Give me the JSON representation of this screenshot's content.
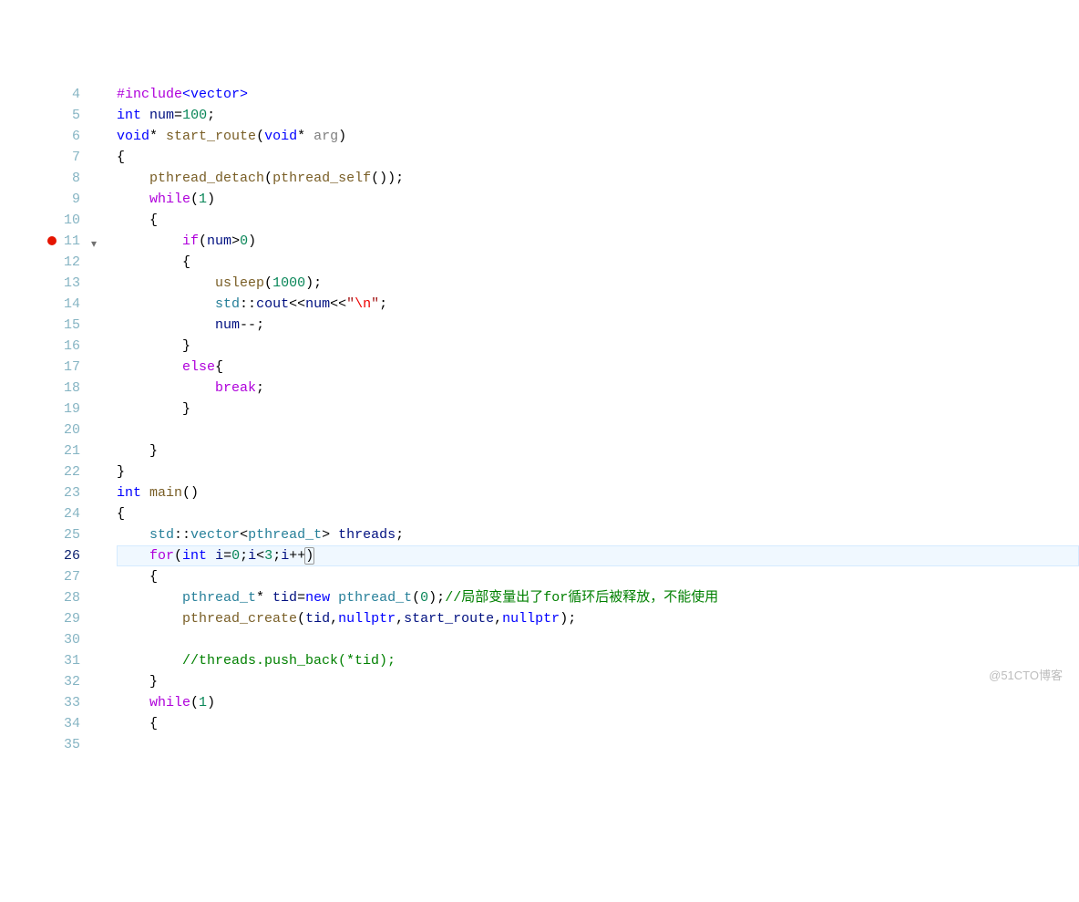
{
  "watermark": "@51CTO博客",
  "startLine": 4,
  "breakpointLine": 11,
  "foldLine": 11,
  "highlightLine": 26,
  "lines": [
    {
      "n": 4,
      "indent": 0,
      "tokens": [
        [
          "tk-macro",
          "#include"
        ],
        [
          "tk-macroinc",
          "<vector>"
        ]
      ]
    },
    {
      "n": 5,
      "indent": 0,
      "tokens": [
        [
          "tk-type",
          "int"
        ],
        [
          "",
          " "
        ],
        [
          "tk-var",
          "num"
        ],
        [
          "tk-op",
          "="
        ],
        [
          "tk-num",
          "100"
        ],
        [
          "tk-punct",
          ";"
        ]
      ]
    },
    {
      "n": 6,
      "indent": 0,
      "tokens": [
        [
          "tk-type",
          "void"
        ],
        [
          "tk-op",
          "* "
        ],
        [
          "tk-func",
          "start_route"
        ],
        [
          "tk-punct",
          "("
        ],
        [
          "tk-type",
          "void"
        ],
        [
          "tk-op",
          "* "
        ],
        [
          "tk-param",
          "arg"
        ],
        [
          "tk-punct",
          ")"
        ]
      ]
    },
    {
      "n": 7,
      "indent": 0,
      "tokens": [
        [
          "tk-punct",
          "{"
        ]
      ]
    },
    {
      "n": 8,
      "indent": 1,
      "tokens": [
        [
          "tk-func",
          "pthread_detach"
        ],
        [
          "tk-punct",
          "("
        ],
        [
          "tk-func",
          "pthread_self"
        ],
        [
          "tk-punct",
          "()"
        ],
        [
          "tk-punct",
          ")"
        ],
        [
          "tk-punct",
          ";"
        ]
      ]
    },
    {
      "n": 9,
      "indent": 1,
      "tokens": [
        [
          "tk-control",
          "while"
        ],
        [
          "tk-punct",
          "("
        ],
        [
          "tk-num",
          "1"
        ],
        [
          "tk-punct",
          ")"
        ]
      ]
    },
    {
      "n": 10,
      "indent": 1,
      "tokens": [
        [
          "tk-punct",
          "{"
        ]
      ]
    },
    {
      "n": 11,
      "indent": 2,
      "tokens": [
        [
          "tk-control",
          "if"
        ],
        [
          "tk-punct",
          "("
        ],
        [
          "tk-var",
          "num"
        ],
        [
          "tk-op",
          ">"
        ],
        [
          "tk-num",
          "0"
        ],
        [
          "tk-punct",
          ")"
        ]
      ]
    },
    {
      "n": 12,
      "indent": 2,
      "tokens": [
        [
          "tk-punct",
          "{"
        ]
      ]
    },
    {
      "n": 13,
      "indent": 3,
      "tokens": [
        [
          "tk-func",
          "usleep"
        ],
        [
          "tk-punct",
          "("
        ],
        [
          "tk-num",
          "1000"
        ],
        [
          "tk-punct",
          ")"
        ],
        [
          "tk-punct",
          ";"
        ]
      ]
    },
    {
      "n": 14,
      "indent": 3,
      "tokens": [
        [
          "tk-namespace",
          "std"
        ],
        [
          "tk-punct",
          "::"
        ],
        [
          "tk-var",
          "cout"
        ],
        [
          "tk-op",
          "<<"
        ],
        [
          "tk-var",
          "num"
        ],
        [
          "tk-op",
          "<<"
        ],
        [
          "tk-str",
          "\""
        ],
        [
          "tk-esc",
          "\\n"
        ],
        [
          "tk-str",
          "\""
        ],
        [
          "tk-punct",
          ";"
        ]
      ]
    },
    {
      "n": 15,
      "indent": 3,
      "tokens": [
        [
          "tk-var",
          "num"
        ],
        [
          "tk-op",
          "--"
        ],
        [
          "tk-punct",
          ";"
        ]
      ]
    },
    {
      "n": 16,
      "indent": 2,
      "tokens": [
        [
          "tk-punct",
          "}"
        ]
      ]
    },
    {
      "n": 17,
      "indent": 2,
      "tokens": [
        [
          "tk-control",
          "else"
        ],
        [
          "tk-punct",
          "{"
        ]
      ]
    },
    {
      "n": 18,
      "indent": 3,
      "tokens": [
        [
          "tk-control",
          "break"
        ],
        [
          "tk-punct",
          ";"
        ]
      ]
    },
    {
      "n": 19,
      "indent": 2,
      "tokens": [
        [
          "tk-punct",
          "}"
        ]
      ]
    },
    {
      "n": 20,
      "indent": 0,
      "tokens": []
    },
    {
      "n": 21,
      "indent": 1,
      "tokens": [
        [
          "tk-punct",
          "}"
        ]
      ]
    },
    {
      "n": 22,
      "indent": 0,
      "tokens": [
        [
          "tk-punct",
          "}"
        ]
      ]
    },
    {
      "n": 23,
      "indent": 0,
      "tokens": [
        [
          "tk-type",
          "int"
        ],
        [
          "",
          " "
        ],
        [
          "tk-func",
          "main"
        ],
        [
          "tk-punct",
          "()"
        ]
      ]
    },
    {
      "n": 24,
      "indent": 0,
      "tokens": [
        [
          "tk-punct",
          "{"
        ]
      ]
    },
    {
      "n": 25,
      "indent": 1,
      "tokens": [
        [
          "tk-namespace",
          "std"
        ],
        [
          "tk-punct",
          "::"
        ],
        [
          "tk-class",
          "vector"
        ],
        [
          "tk-punct",
          "<"
        ],
        [
          "tk-class",
          "pthread_t"
        ],
        [
          "tk-punct",
          "> "
        ],
        [
          "tk-var",
          "threads"
        ],
        [
          "tk-punct",
          ";"
        ]
      ]
    },
    {
      "n": 26,
      "indent": 1,
      "tokens": [
        [
          "tk-control",
          "for"
        ],
        [
          "tk-punct",
          "("
        ],
        [
          "tk-type",
          "int"
        ],
        [
          "",
          " "
        ],
        [
          "tk-var",
          "i"
        ],
        [
          "tk-op",
          "="
        ],
        [
          "tk-num",
          "0"
        ],
        [
          "tk-punct",
          ";"
        ],
        [
          "tk-var",
          "i"
        ],
        [
          "tk-op",
          "<"
        ],
        [
          "tk-num",
          "3"
        ],
        [
          "tk-punct",
          ";"
        ],
        [
          "tk-var",
          "i"
        ],
        [
          "tk-op",
          "++"
        ],
        [
          "cursor-box",
          ")"
        ]
      ]
    },
    {
      "n": 27,
      "indent": 1,
      "tokens": [
        [
          "tk-punct",
          "{"
        ]
      ]
    },
    {
      "n": 28,
      "indent": 2,
      "tokens": [
        [
          "tk-class",
          "pthread_t"
        ],
        [
          "tk-op",
          "* "
        ],
        [
          "tk-var",
          "tid"
        ],
        [
          "tk-op",
          "="
        ],
        [
          "tk-keyword",
          "new"
        ],
        [
          "",
          " "
        ],
        [
          "tk-class",
          "pthread_t"
        ],
        [
          "tk-punct",
          "("
        ],
        [
          "tk-num",
          "0"
        ],
        [
          "tk-punct",
          ")"
        ],
        [
          "tk-punct",
          ";"
        ],
        [
          "tk-comment",
          "//局部变量出了for循环后被释放，不能使用"
        ]
      ]
    },
    {
      "n": 29,
      "indent": 2,
      "tokens": [
        [
          "tk-func",
          "pthread_create"
        ],
        [
          "tk-punct",
          "("
        ],
        [
          "tk-var",
          "tid"
        ],
        [
          "tk-punct",
          ","
        ],
        [
          "tk-keyword",
          "nullptr"
        ],
        [
          "tk-punct",
          ","
        ],
        [
          "tk-var",
          "start_route"
        ],
        [
          "tk-punct",
          ","
        ],
        [
          "tk-keyword",
          "nullptr"
        ],
        [
          "tk-punct",
          ")"
        ],
        [
          "tk-punct",
          ";"
        ]
      ]
    },
    {
      "n": 30,
      "indent": 0,
      "tokens": []
    },
    {
      "n": 31,
      "indent": 2,
      "tokens": [
        [
          "tk-comment",
          "//threads.push_back(*tid);"
        ]
      ]
    },
    {
      "n": 32,
      "indent": 1,
      "tokens": [
        [
          "tk-punct",
          "}"
        ]
      ]
    },
    {
      "n": 33,
      "indent": 1,
      "tokens": [
        [
          "tk-control",
          "while"
        ],
        [
          "tk-punct",
          "("
        ],
        [
          "tk-num",
          "1"
        ],
        [
          "tk-punct",
          ")"
        ]
      ]
    },
    {
      "n": 34,
      "indent": 1,
      "tokens": [
        [
          "tk-punct",
          "{"
        ]
      ]
    },
    {
      "n": 35,
      "indent": 0,
      "tokens": []
    }
  ]
}
